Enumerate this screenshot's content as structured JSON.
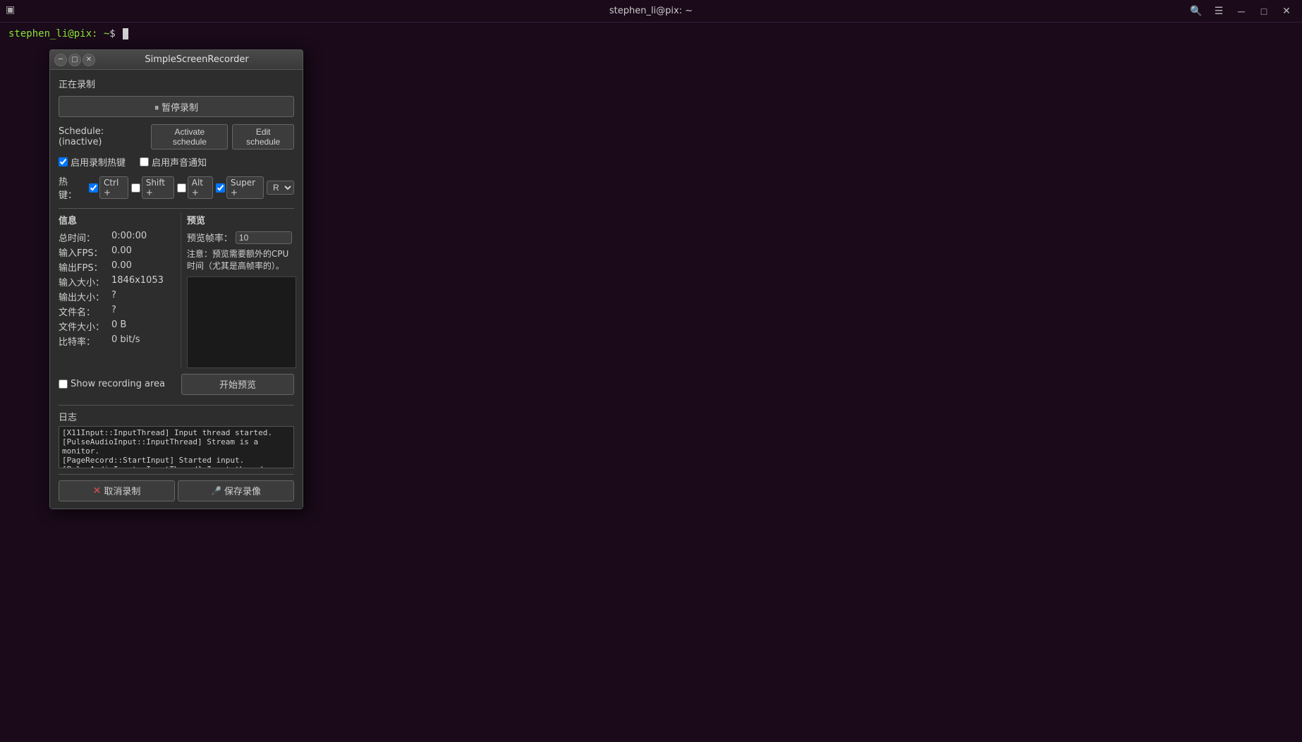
{
  "titlebar": {
    "title": "stephen_li@pix: ~",
    "icon": "⬛"
  },
  "terminal": {
    "prompt": "stephen_li@pix:~$ ",
    "cursor": "|"
  },
  "dialog": {
    "title": "SimpleScreenRecorder",
    "recording_status": "正在录制",
    "pause_btn": "⏸ 暂停录制",
    "schedule_label": "Schedule: (inactive)",
    "activate_schedule_btn": "Activate schedule",
    "edit_schedule_btn": "Edit schedule",
    "enable_hotkey_label": "启用录制热键",
    "enable_audio_notify_label": "启用声音通知",
    "hotkey_label": "热键：",
    "hotkey_ctrl": "Ctrl +",
    "hotkey_shift": "Shift +",
    "hotkey_alt": "Alt +",
    "hotkey_super": "Super +",
    "hotkey_key": "R",
    "info_header": "信息",
    "preview_header": "预览",
    "info_rows": [
      {
        "key": "总时间：",
        "val": "0:00:00"
      },
      {
        "key": "输入FPS：",
        "val": "0.00"
      },
      {
        "key": "输出FPS：",
        "val": "0.00"
      },
      {
        "key": "输入大小：",
        "val": "1846x1053"
      },
      {
        "key": "输出大小：",
        "val": "?"
      },
      {
        "key": "文件名：",
        "val": "?"
      },
      {
        "key": "文件大小：",
        "val": "0 B"
      },
      {
        "key": "比特率：",
        "val": "0 bit/s"
      }
    ],
    "preview_fps_label": "预览帧率：",
    "preview_fps_value": "10",
    "preview_note": "注意：预览需要额外的CPU时间（尤其是高帧率的）。",
    "show_recording_area_label": "Show recording area",
    "start_preview_btn": "开始预览",
    "log_header": "日志",
    "log_lines": [
      "[X11Input::InputThread] Input thread started.",
      "[PulseAudioInput::InputThread] Stream is a monitor.",
      "[PageRecord::StartInput] Started input.",
      "[PulseAudioInput::InputThread] Input thread started."
    ],
    "cancel_btn": "取消录制",
    "save_btn": "保存录像"
  }
}
